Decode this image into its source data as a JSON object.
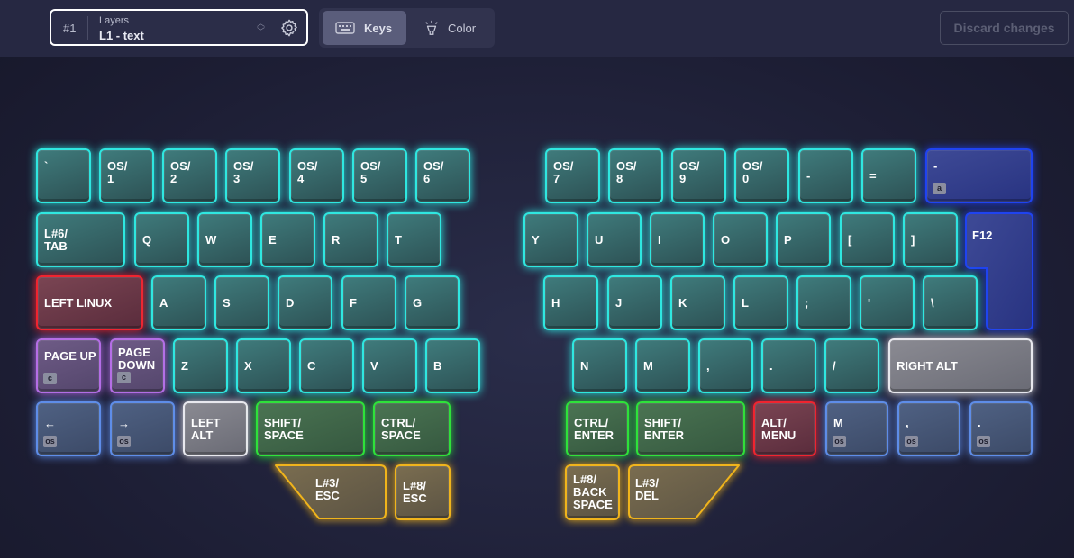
{
  "layer_select": {
    "number": "#1",
    "caption": "Layers",
    "value": "L1 - text"
  },
  "tabs": [
    {
      "label": "Keys",
      "active": true
    },
    {
      "label": "Color",
      "active": false
    }
  ],
  "discard_label": "Discard changes",
  "colors": {
    "teal": "#2fe7e0",
    "blue": "#1f43f0",
    "red": "#f0242f",
    "purple": "#b56ee6",
    "light_blue": "#5e8de8",
    "white": "#e8e8ee",
    "green": "#2ee23a",
    "yellow": "#f0b41c"
  },
  "keys": {
    "backtick": "`",
    "os1": "OS/\n1",
    "os2": "OS/\n2",
    "os3": "OS/\n3",
    "os4": "OS/\n4",
    "os5": "OS/\n5",
    "os6": "OS/\n6",
    "os7": "OS/\n7",
    "os8": "OS/\n8",
    "os9": "OS/\n9",
    "os0": "OS/\n0",
    "minus": "-",
    "equals": "=",
    "dash": "-",
    "dash_sub": "a",
    "tab": "L#6/\nTAB",
    "q": "Q",
    "w": "W",
    "e": "E",
    "r": "R",
    "t": "T",
    "y": "Y",
    "u": "U",
    "i": "I",
    "o": "O",
    "p": "P",
    "lbracket": "[",
    "rbracket": "]",
    "f12": "F12",
    "left_linux": "LEFT LINUX",
    "a": "A",
    "s": "S",
    "d": "D",
    "f": "F",
    "g": "G",
    "h": "H",
    "j": "J",
    "k": "K",
    "l": "L",
    "semicolon": ";",
    "quote": "'",
    "backslash": "\\",
    "page_up": "PAGE UP",
    "page_up_sub": "c",
    "page_down": "PAGE\nDOWN",
    "page_down_sub": "c",
    "z": "Z",
    "x": "X",
    "c": "C",
    "v": "V",
    "b": "B",
    "n": "N",
    "m": "M",
    "comma": ",",
    "period": ".",
    "slash": "/",
    "right_alt": "RIGHT ALT",
    "left_arrow": "←",
    "left_arrow_sub": "os",
    "right_arrow": "→",
    "right_arrow_sub": "os",
    "left_alt": "LEFT\nALT",
    "shift_space": "SHIFT/\nSPACE",
    "ctrl_space": "CTRL/\nSPACE",
    "ctrl_enter": "CTRL/\nENTER",
    "shift_enter": "SHIFT/\nENTER",
    "alt_menu": "ALT/\nMENU",
    "m_os": "M",
    "m_os_sub": "os",
    "comma_os": ",",
    "comma_os_sub": "os",
    "period_os": ".",
    "period_os_sub": "os",
    "l3_esc": "L#3/\nESC",
    "l8_esc": "L#8/\nESC",
    "l8_backspace": "L#8/\nBACK\nSPACE",
    "l3_del": "L#3/\nDEL"
  }
}
